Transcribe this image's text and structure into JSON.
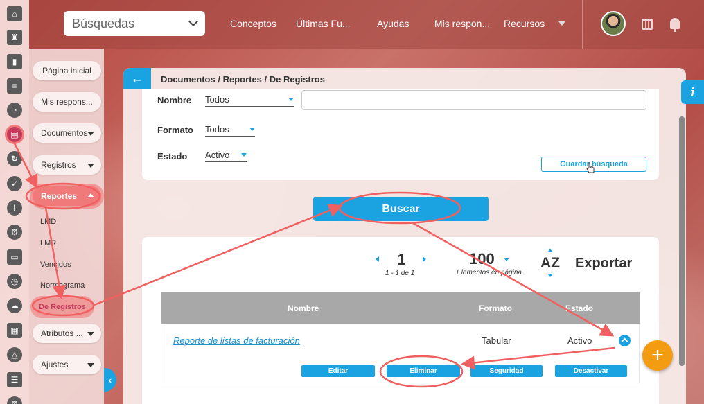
{
  "topbar": {
    "search_placeholder": "Búsquedas",
    "nav": [
      "Conceptos",
      "Últimas Fu...",
      "Ayudas",
      "Mis respon...",
      "Recursos"
    ]
  },
  "menu": {
    "pagina_inicial": "Página inicial",
    "mis_respon": "Mis respons...",
    "documentos": "Documentos",
    "registros": "Registros",
    "reportes": "Reportes",
    "sub_items": [
      "LMD",
      "LMR",
      "Vencidos",
      "Normograma",
      "De Registros"
    ],
    "atributos": "Atributos ...",
    "ajustes": "Ajustes"
  },
  "panel": {
    "breadcrumb": "Documentos / Reportes / De Registros",
    "filters": {
      "nombre_label": "Nombre",
      "nombre_value": "Todos",
      "formato_label": "Formato",
      "formato_value": "Todos",
      "estado_label": "Estado",
      "estado_value": "Activo",
      "save_search": "Guardar búsqueda"
    },
    "buscar": "Buscar",
    "results": {
      "page": "1",
      "page_of": "1 - 1 de 1",
      "per_page": "100",
      "per_page_label": "Elementos en página",
      "sort": "AZ",
      "export": "Exportar",
      "columns": [
        "Nombre",
        "Formato",
        "Estado"
      ],
      "row": {
        "name": "Reporte de listas de facturación",
        "format": "Tabular",
        "status": "Activo"
      },
      "actions": [
        "Editar",
        "Eliminar",
        "Seguridad",
        "Desactivar"
      ]
    }
  },
  "info_tab": "i",
  "fab": "+",
  "colors": {
    "accent": "#1aa3e0",
    "annotation": "#f06060",
    "fab": "#f39c12"
  }
}
